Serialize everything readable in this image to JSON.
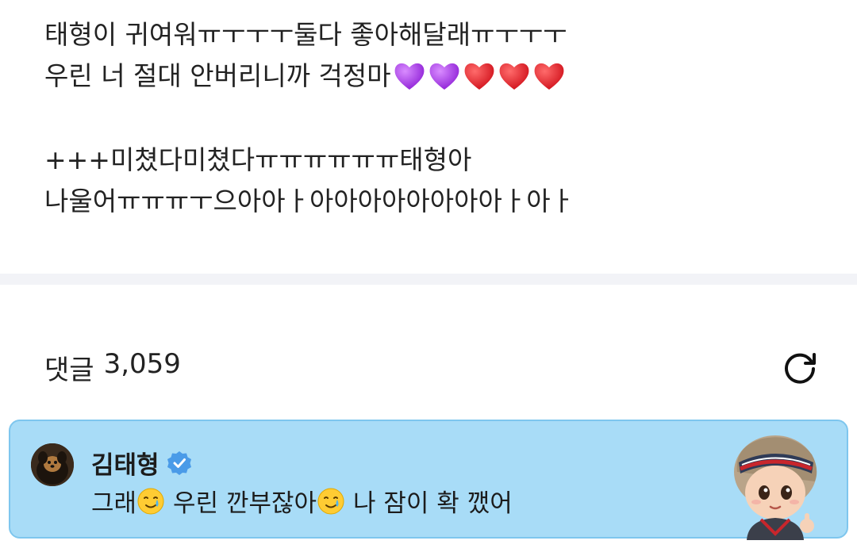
{
  "post": {
    "line1": "태형이 귀여워ㅠㅜㅜㅜ둘다 좋아해달래ㅠㅜㅜㅜ",
    "line2": "우린 너 절대 안버리니까 걱정마",
    "line2_emoji": [
      "purple-heart",
      "purple-heart",
      "red-heart",
      "red-heart",
      "red-heart"
    ],
    "line3": "+++미쳤다미쳤다ㅠㅠㅠㅠㅠㅠ태형아",
    "line4": "나울어ㅠㅠㅠㅜ으아아ㅏ아아아아아아아아ㅏ아ㅏ"
  },
  "comments": {
    "label": "댓글",
    "count": "3,059",
    "refresh_icon": "refresh-icon"
  },
  "pinned_comment": {
    "author": "김태형",
    "verified_icon": "verified-badge-icon",
    "text_part1": "그래",
    "text_part2": "우린 깐부잖아",
    "text_part3": "나 잠이 확 깼어",
    "emoji": "smiling-face-with-tear",
    "colors": {
      "background": "#a8dcf7",
      "border": "#7ec6ee",
      "verified": "#4a9be8"
    }
  }
}
